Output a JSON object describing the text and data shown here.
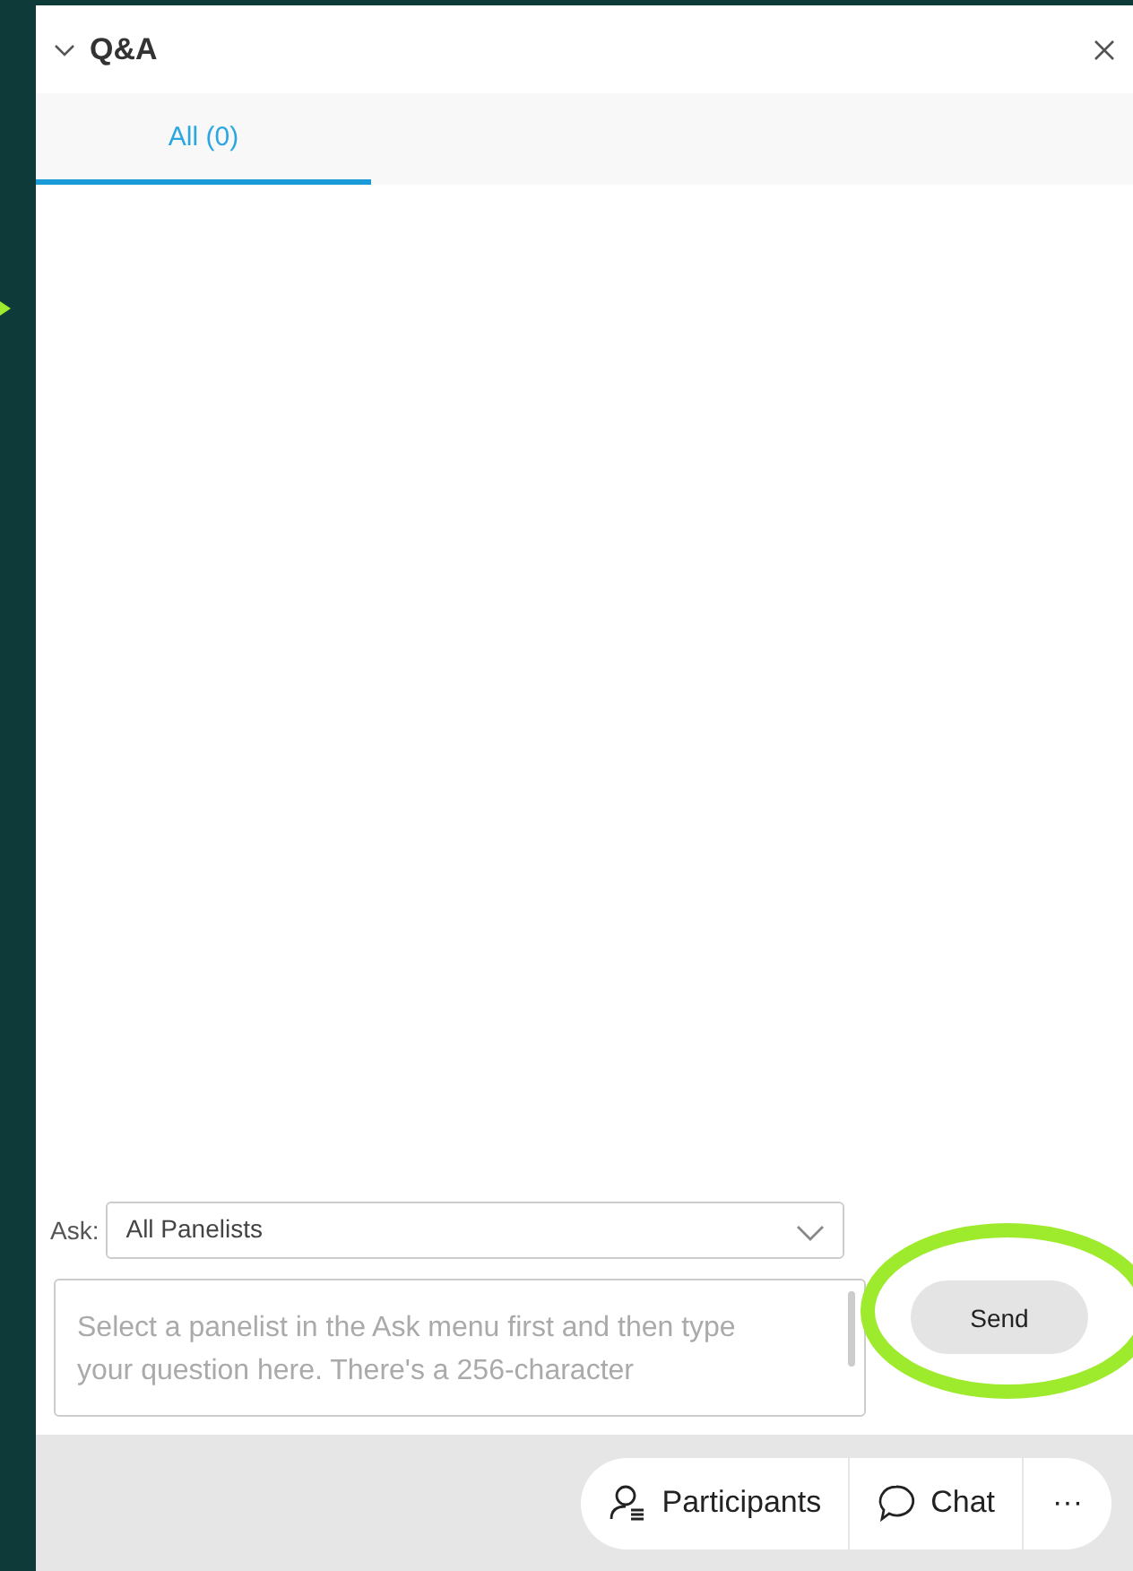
{
  "panel": {
    "title": "Q&A",
    "expanded": true
  },
  "tabs": [
    {
      "label": "All (0)",
      "selected": true
    }
  ],
  "ask": {
    "label": "Ask:",
    "value": "All Panelists"
  },
  "question": {
    "placeholder": "Select a panelist in the Ask menu first and then type your question here. There's a 256-character"
  },
  "send_button": "Send",
  "toolbar": [
    {
      "kind": "participants",
      "label": "Participants"
    },
    {
      "kind": "chat",
      "label": "Chat"
    },
    {
      "kind": "more",
      "label": "···"
    }
  ],
  "annotations": {
    "highlight_ellipse": true,
    "arrow_tip": true
  }
}
